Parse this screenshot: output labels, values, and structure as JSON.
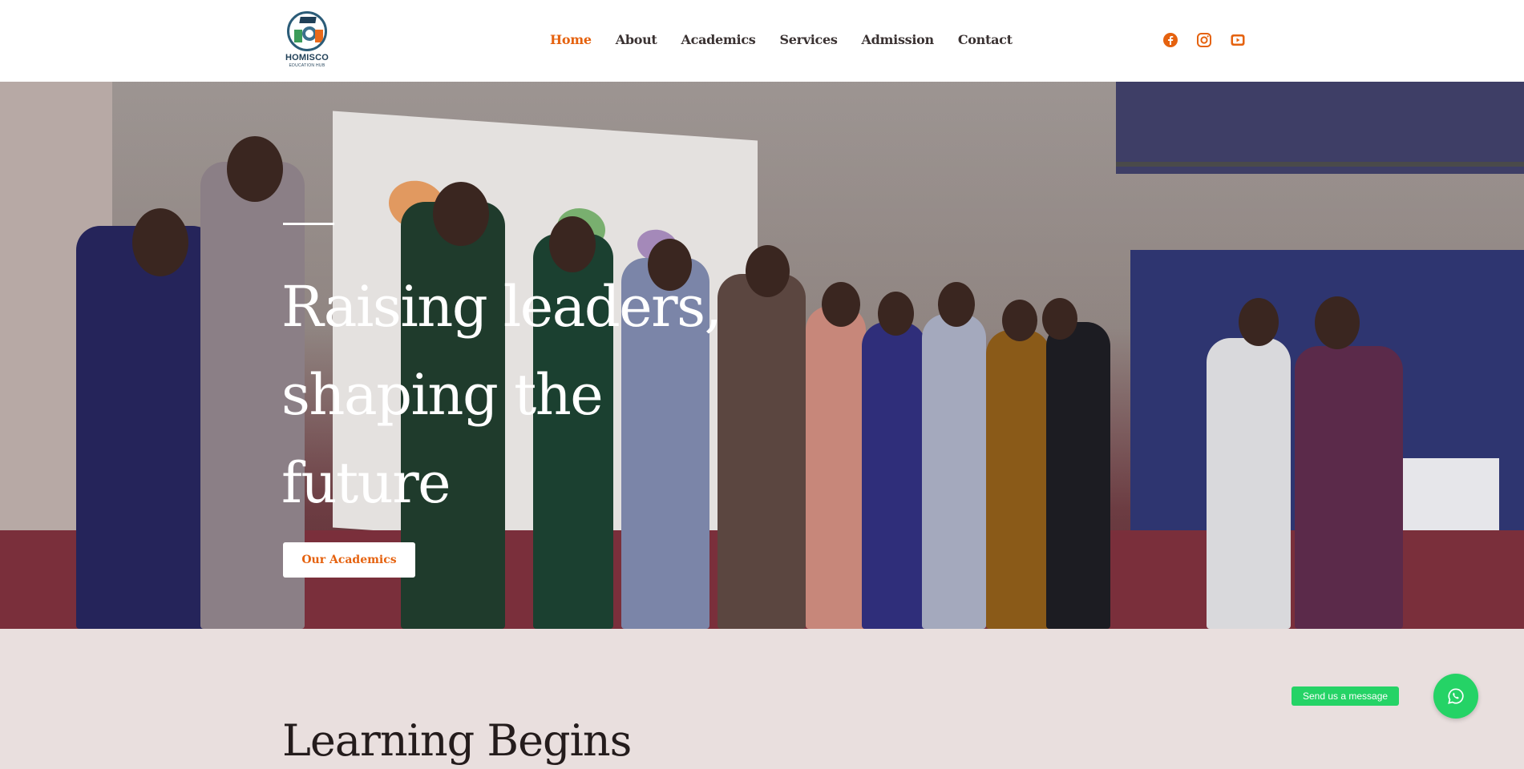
{
  "brand": {
    "name": "HOMISCO",
    "subtitle": "EDUCATION HUB"
  },
  "nav": {
    "items": [
      {
        "label": "Home",
        "active": true
      },
      {
        "label": "About",
        "active": false
      },
      {
        "label": "Academics",
        "active": false
      },
      {
        "label": "Services",
        "active": false
      },
      {
        "label": "Admission",
        "active": false
      },
      {
        "label": "Contact",
        "active": false
      }
    ]
  },
  "social": [
    "facebook-icon",
    "instagram-icon",
    "youtube-icon"
  ],
  "hero": {
    "title_lines": [
      "Raising leaders,",
      "shaping the",
      "future"
    ],
    "button_label": "Our Academics"
  },
  "section": {
    "title": "Learning Begins"
  },
  "whatsapp": {
    "label": "Send us a message"
  },
  "colors": {
    "accent": "#e5620f",
    "whatsapp": "#25d366",
    "section_bg": "#e9dfde"
  }
}
